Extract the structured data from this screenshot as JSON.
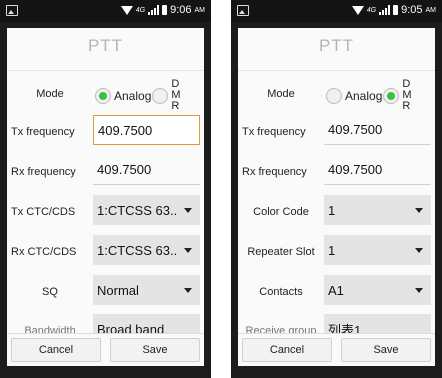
{
  "left": {
    "status": {
      "time": "9:06",
      "ampm": "AM",
      "network": "4G"
    },
    "title": "PTT",
    "mode": {
      "label": "Mode",
      "options": [
        "Analog",
        "DMR"
      ],
      "selected": "Analog"
    },
    "rows": [
      {
        "label": "Tx frequency",
        "kind": "text",
        "value": "409.7500",
        "focused": true
      },
      {
        "label": "Rx frequency",
        "kind": "text",
        "value": "409.7500"
      },
      {
        "label": "Tx CTC/CDS",
        "kind": "select",
        "value": "1:CTCSS 63.."
      },
      {
        "label": "Rx CTC/CDS",
        "kind": "select",
        "value": "1:CTCSS 63.."
      },
      {
        "label": "SQ",
        "kind": "select",
        "value": "Normal"
      },
      {
        "label": "Bandwidth",
        "kind": "select",
        "value": "Broad band"
      }
    ],
    "buttons": {
      "cancel": "Cancel",
      "save": "Save"
    }
  },
  "right": {
    "status": {
      "time": "9:05",
      "ampm": "AM",
      "network": "4G"
    },
    "title": "PTT",
    "mode": {
      "label": "Mode",
      "options": [
        "Analog",
        "DMR"
      ],
      "selected": "DMR"
    },
    "rows": [
      {
        "label": "Tx frequency",
        "kind": "text",
        "value": "409.7500"
      },
      {
        "label": "Rx frequency",
        "kind": "text",
        "value": "409.7500"
      },
      {
        "label": "Color Code",
        "kind": "select",
        "value": "1"
      },
      {
        "label": "Repeater Slot",
        "kind": "select",
        "value": "1"
      },
      {
        "label": "Contacts",
        "kind": "select",
        "value": "A1"
      },
      {
        "label": "Receive group",
        "kind": "select",
        "value": "列表1"
      }
    ],
    "buttons": {
      "cancel": "Cancel",
      "save": "Save"
    }
  }
}
